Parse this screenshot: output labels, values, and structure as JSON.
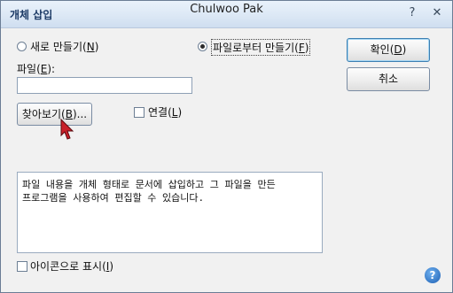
{
  "window": {
    "title": "개체 삽입",
    "owner": "Chulwoo Pak",
    "help_button": "?",
    "close_button": "✕"
  },
  "source": {
    "create_new_label": "새로 만들기(N)",
    "create_new_selected": false,
    "from_file_label": "파일로부터 만들기(F)",
    "from_file_selected": true
  },
  "file": {
    "label": "파일(E):",
    "value": ""
  },
  "browse_button": "찾아보기(B)...",
  "link_checkbox": {
    "label": "연결(L)",
    "checked": false
  },
  "description": {
    "line1": "파일 내용을 개체 형태로 문서에 삽입하고 그 파일을 만든",
    "line2": "프로그램을 사용하여 편집할 수 있습니다."
  },
  "display_as_icon_checkbox": {
    "label": "아이콘으로 표시(I)",
    "checked": false
  },
  "ok_button": "확인(D)",
  "cancel_button": "취소",
  "help_icon_text": "?",
  "icons": [
    "radio-icon",
    "checkbox-icon",
    "mouse-cursor-icon",
    "help-icon",
    "close-icon"
  ]
}
